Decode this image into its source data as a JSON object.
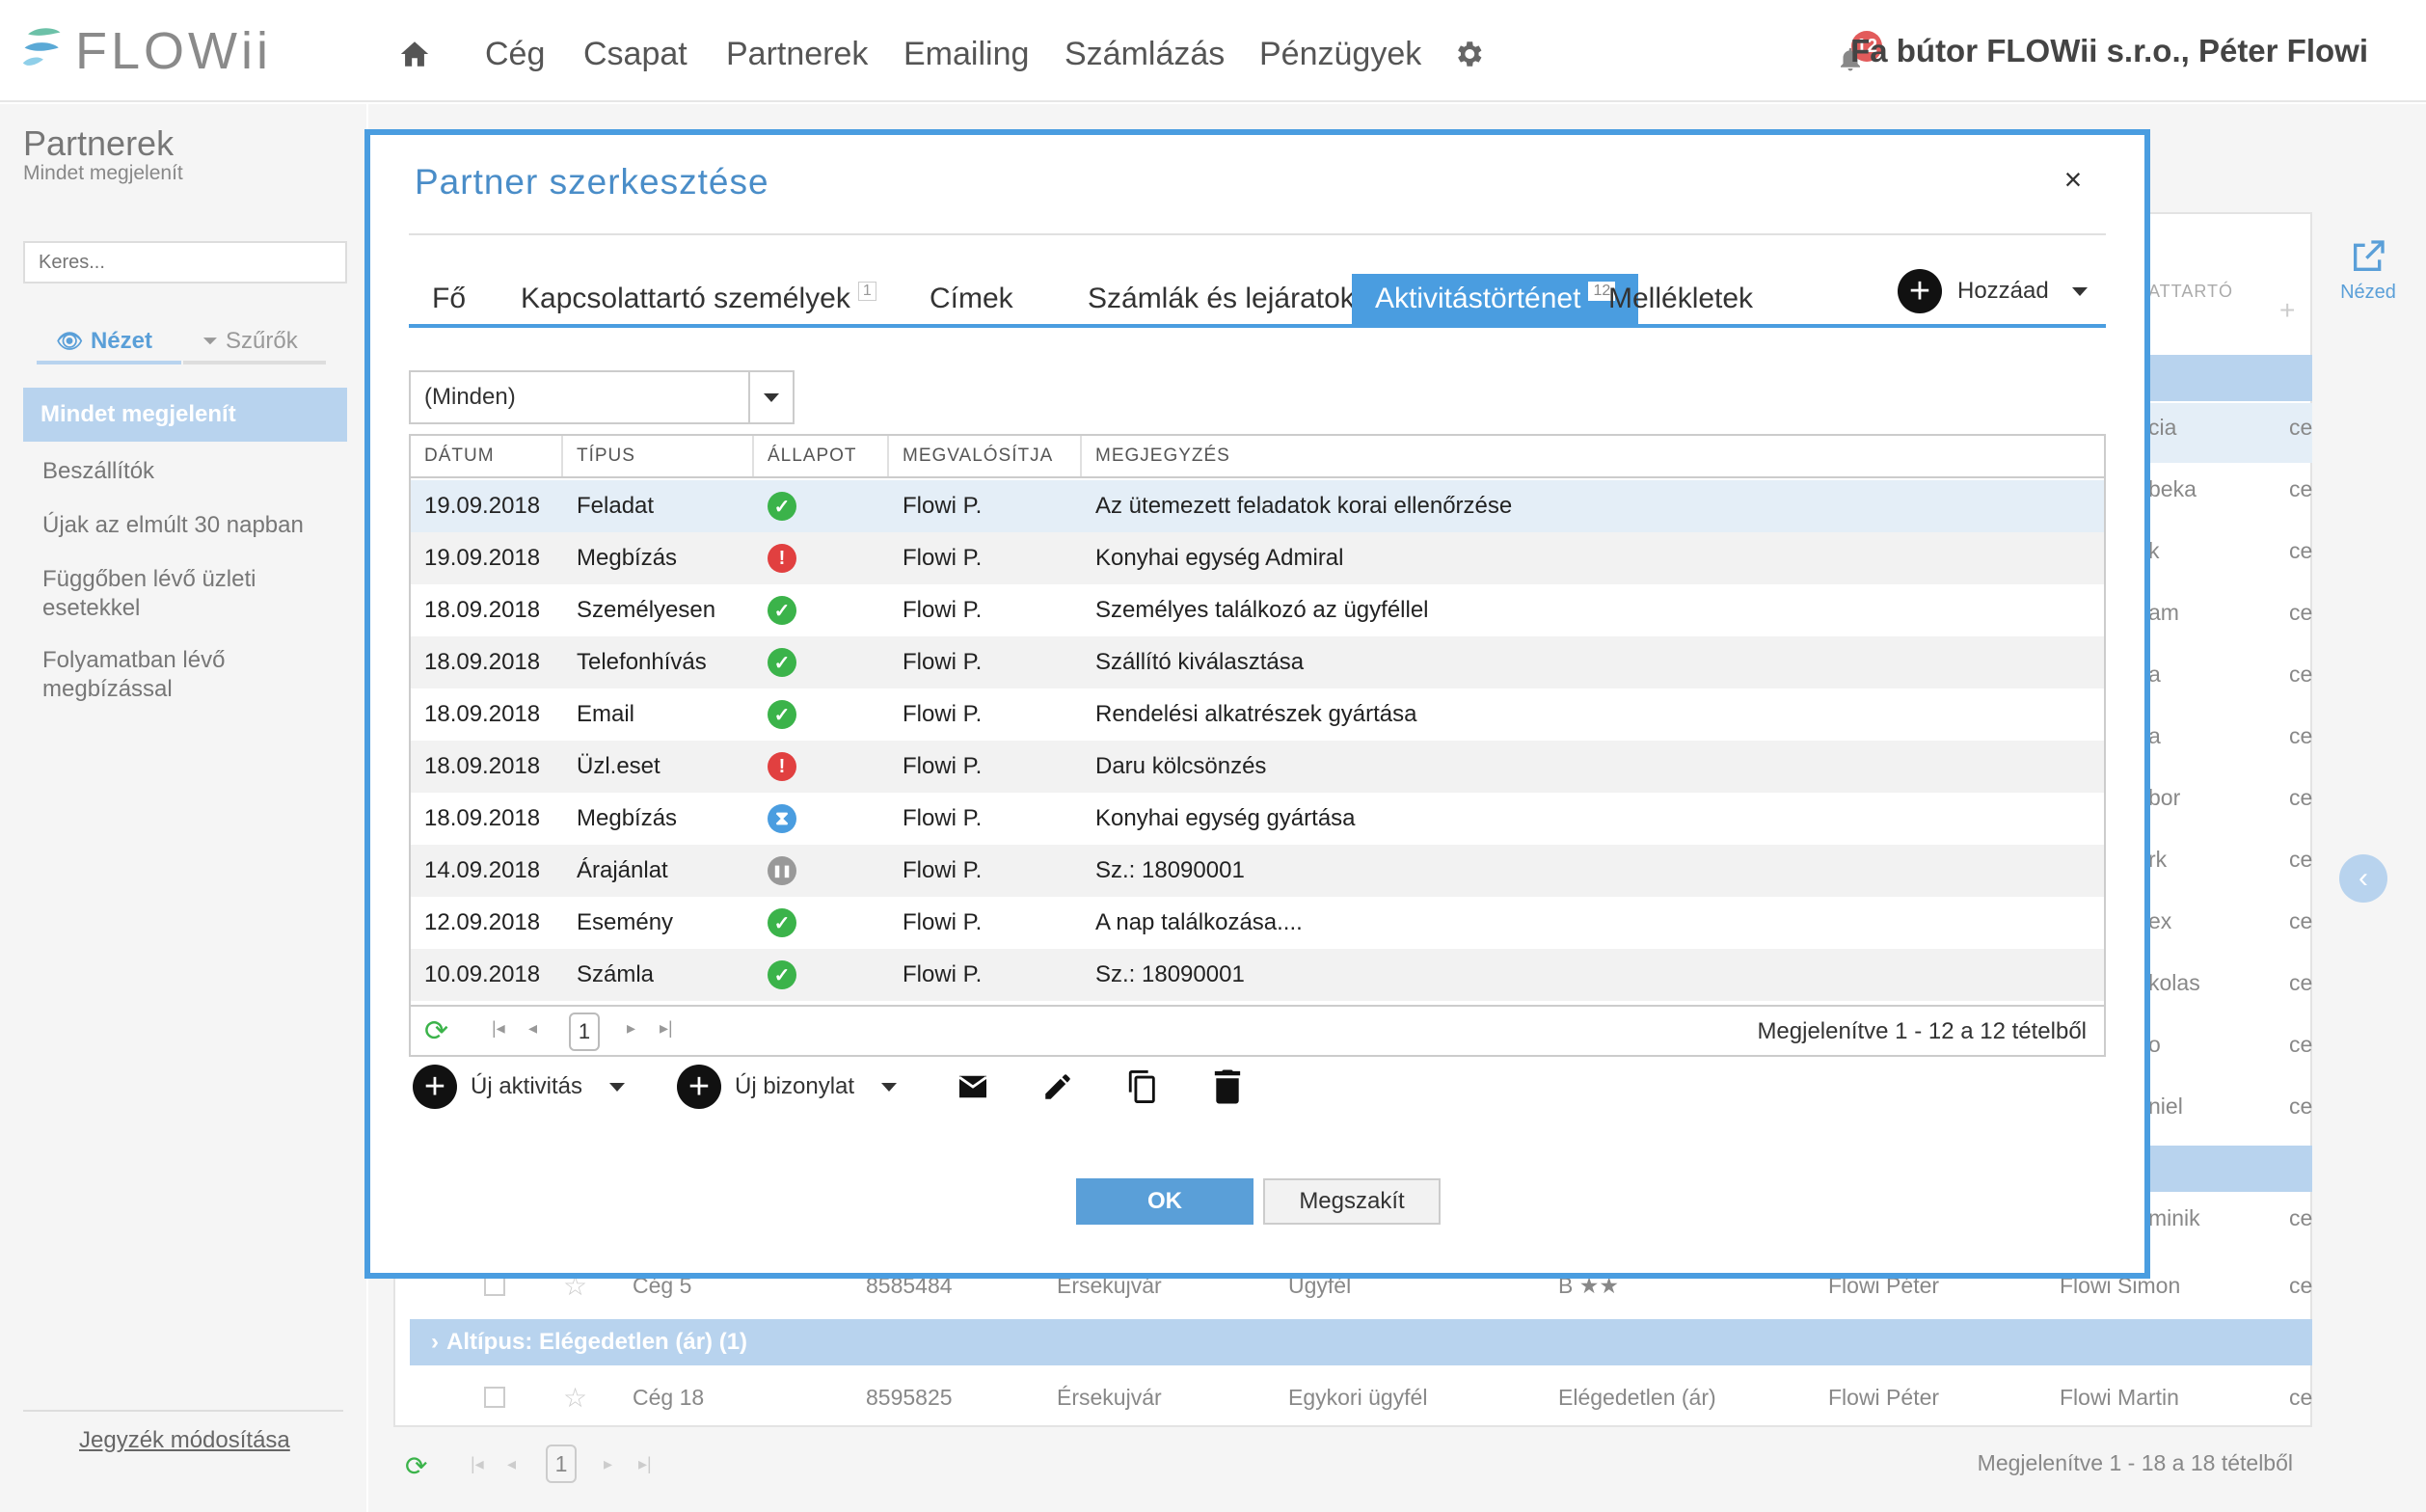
{
  "header": {
    "brand": "FLOWii",
    "nav": [
      "Cég",
      "Csapat",
      "Partnerek",
      "Emailing",
      "Számlázás",
      "Pénzügyek"
    ],
    "notification_count": "12",
    "user": "Fa bútor FLOWii s.r.o., Péter Flowi"
  },
  "left": {
    "title": "Partnerek",
    "subtitle": "Mindet megjelenít",
    "search_placeholder": "Keres...",
    "tab_view": "Nézet",
    "tab_filters": "Szűrők",
    "active_item": "Mindet megjelenít",
    "items": [
      "Beszállítók",
      "Újak az elmúlt 30 napban",
      "Függőben lévő üzleti esetekkel",
      "Folyamatban lévő megbízással"
    ],
    "edit_link": "Jegyzék módosítása"
  },
  "background": {
    "col_header": "ATTARTÓ",
    "side_view_label": "Nézed",
    "right_fragments": [
      "cia",
      "beka",
      "k",
      "am",
      "a",
      "a",
      "bor",
      "rk",
      "ex",
      "kolas",
      "o",
      "niel",
      "minik"
    ],
    "right_cell": "ce",
    "row_a": {
      "company": "Cég 5",
      "id": "8585484",
      "city": "Érsekujvár",
      "type": "Ügyfél",
      "rating": "B ★★",
      "owner": "Flowi Péter",
      "contact": "Flowi Simon",
      "trail": "ce"
    },
    "group_label": "Altípus: Elégedetlen (ár) (1)",
    "row_b": {
      "company": "Cég 18",
      "id": "8595825",
      "city": "Érsekujvár",
      "type": "Egykori ügyfél",
      "rating": "Elégedetlen (ár)",
      "owner": "Flowi Péter",
      "contact": "Flowi Martin",
      "trail": "ce"
    },
    "pager_page": "1",
    "pager_info": "Megjelenítve 1 - 18 a 18 tételből"
  },
  "modal": {
    "title": "Partner szerkesztése",
    "close": "×",
    "tabs": [
      {
        "label": "Fő",
        "count": ""
      },
      {
        "label": "Kapcsolattartó személyek",
        "count": "1"
      },
      {
        "label": "Címek",
        "count": ""
      },
      {
        "label": "Számlák és lejáratok",
        "count": ""
      },
      {
        "label": "Aktivitástörténet",
        "count": "12"
      },
      {
        "label": "Mellékletek",
        "count": ""
      }
    ],
    "add_label": "Hozzáad",
    "filter_value": "(Minden)",
    "columns": [
      "DÁTUM",
      "TÍPUS",
      "ÁLLAPOT",
      "MEGVALÓSÍTJA",
      "MEGJEGYZÉS"
    ],
    "rows": [
      {
        "date": "19.09.2018",
        "type": "Feladat",
        "status": "ok",
        "by": "Flowi P.",
        "note": "Az ütemezett feladatok korai ellenőrzése"
      },
      {
        "date": "19.09.2018",
        "type": "Megbízás",
        "status": "err",
        "by": "Flowi P.",
        "note": "Konyhai egység Admiral"
      },
      {
        "date": "18.09.2018",
        "type": "Személyesen",
        "status": "ok",
        "by": "Flowi P.",
        "note": "Személyes találkozó az ügyféllel"
      },
      {
        "date": "18.09.2018",
        "type": "Telefonhívás",
        "status": "ok",
        "by": "Flowi P.",
        "note": "Szállító kiválasztása"
      },
      {
        "date": "18.09.2018",
        "type": "Email",
        "status": "ok",
        "by": "Flowi P.",
        "note": "Rendelési alkatrészek gyártása"
      },
      {
        "date": "18.09.2018",
        "type": "Üzl.eset",
        "status": "err",
        "by": "Flowi P.",
        "note": "Daru kölcsönzés"
      },
      {
        "date": "18.09.2018",
        "type": "Megbízás",
        "status": "wait",
        "by": "Flowi P.",
        "note": "Konyhai egység gyártása"
      },
      {
        "date": "14.09.2018",
        "type": "Árajánlat",
        "status": "pause",
        "by": "Flowi P.",
        "note": "Sz.: 18090001"
      },
      {
        "date": "12.09.2018",
        "type": "Esemény",
        "status": "ok",
        "by": "Flowi P.",
        "note": "A nap találkozása...."
      },
      {
        "date": "10.09.2018",
        "type": "Számla",
        "status": "ok",
        "by": "Flowi P.",
        "note": "Sz.: 18090001"
      }
    ],
    "pager_page": "1",
    "pager_info": "Megjelenítve 1 - 12 a 12 tételből",
    "new_activity": "Új aktivitás",
    "new_document": "Új bizonylat",
    "ok": "OK",
    "cancel": "Megszakít"
  }
}
